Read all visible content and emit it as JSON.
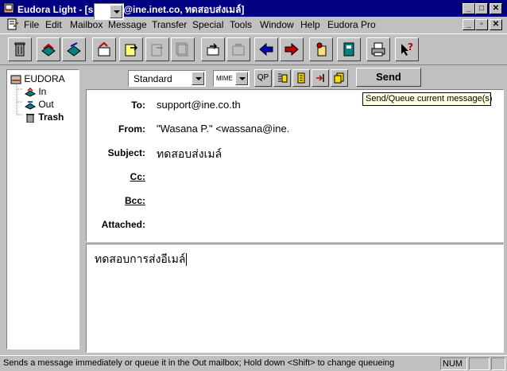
{
  "window": {
    "title": "Eudora Light - [support@ine.inet.co, ทดสอบส่งเมล์]",
    "controls": [
      "_",
      "□",
      "✕"
    ]
  },
  "menu": {
    "items": [
      "File",
      "Edit",
      "Mailbox",
      "Message",
      "Transfer",
      "Special",
      "Tools",
      "Window",
      "Help",
      "Eudora Pro"
    ],
    "mdi_controls": [
      "_",
      "▫",
      "✕"
    ]
  },
  "toolbar": {
    "buttons": [
      "trash-icon",
      "check-mail-icon",
      "send-queued-icon",
      "reply-icon",
      "forward-icon",
      "redirect-icon",
      "send-again-icon",
      "new-message-icon",
      "attach-icon",
      "previous-icon",
      "next-icon",
      "address-icon",
      "address-book-icon",
      "print-icon",
      "help-icon"
    ]
  },
  "mailboxes": {
    "root": "EUDORA",
    "items": [
      {
        "label": "In",
        "bold": false
      },
      {
        "label": "Out",
        "bold": false
      },
      {
        "label": "Trash",
        "bold": true
      }
    ]
  },
  "message_bar": {
    "priority": "",
    "signature": "Standard",
    "encoding": "MIME",
    "qp_label": "QP",
    "send_label": "Send",
    "tooltip": "Send/Queue current message(s)"
  },
  "headers": {
    "to_label": "To:",
    "to_value": "support@ine.co.th",
    "from_label": "From:",
    "from_value": "\"Wasana P.\" <wassana@ine.",
    "subject_label": "Subject:",
    "subject_value": "ทดสอบส่งเมล์",
    "cc_label": "Cc:",
    "cc_value": "",
    "bcc_label": "Bcc:",
    "bcc_value": "",
    "attached_label": "Attached:",
    "attached_value": ""
  },
  "body": {
    "text": "ทดสอบการส่งอีเมล์"
  },
  "status": {
    "message": "Sends a message immediately or queue it in the Out mailbox; Hold down <Shift> to change queueing",
    "num": "NUM"
  },
  "colors": {
    "titlebar": "#000080",
    "face": "#c0c0c0",
    "tooltip": "#ffffe1"
  }
}
